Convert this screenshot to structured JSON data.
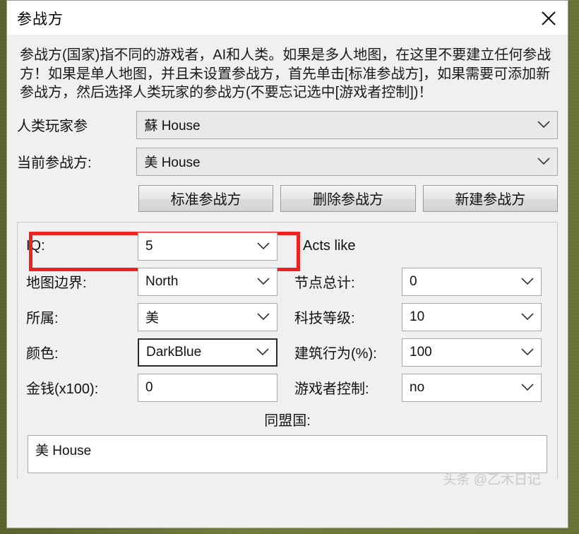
{
  "window": {
    "title": "参战方",
    "close_icon": "close-icon"
  },
  "description": "参战方(国家)指不同的游戏者，AI和人类。如果是多人地图，在这里不要建立任何参战方！如果是单人地图，并且未设置参战方，首先单击[标准参战方]，如果需要可添加新参战方，然后选择人类玩家的参战方(不要忘记选中[游戏者控制])！",
  "top_fields": [
    {
      "label": "人类玩家参",
      "value": "蘇 House"
    },
    {
      "label": "当前参战方:",
      "value": "美 House"
    }
  ],
  "buttons": {
    "standard": "标准参战方",
    "delete": "删除参战方",
    "new": "新建参战方"
  },
  "settings": {
    "iq": {
      "label": "IQ:",
      "value": "5"
    },
    "acts_like": "Acts like",
    "map_border": {
      "label": "地图边界:",
      "value": "North"
    },
    "node_total": {
      "label": "节点总计:",
      "value": "0"
    },
    "belongs_to": {
      "label": "所属:",
      "value": "美"
    },
    "tech_level": {
      "label": "科技等级:",
      "value": "10"
    },
    "color": {
      "label": "颜色:",
      "value": "DarkBlue"
    },
    "build_behavior": {
      "label": "建筑行为(%):",
      "value": "100"
    },
    "money": {
      "label": "金钱(x100):",
      "value": "0"
    },
    "player_control": {
      "label": "游戏者控制:",
      "value": "no"
    }
  },
  "allies": {
    "title": "同盟国:",
    "items": [
      "美 House"
    ]
  },
  "watermark": "头条 @乙木日记",
  "colors": {
    "highlight": "#ee2222",
    "desktop": "#6b7535",
    "dialog_bg": "#f0f0f0"
  }
}
